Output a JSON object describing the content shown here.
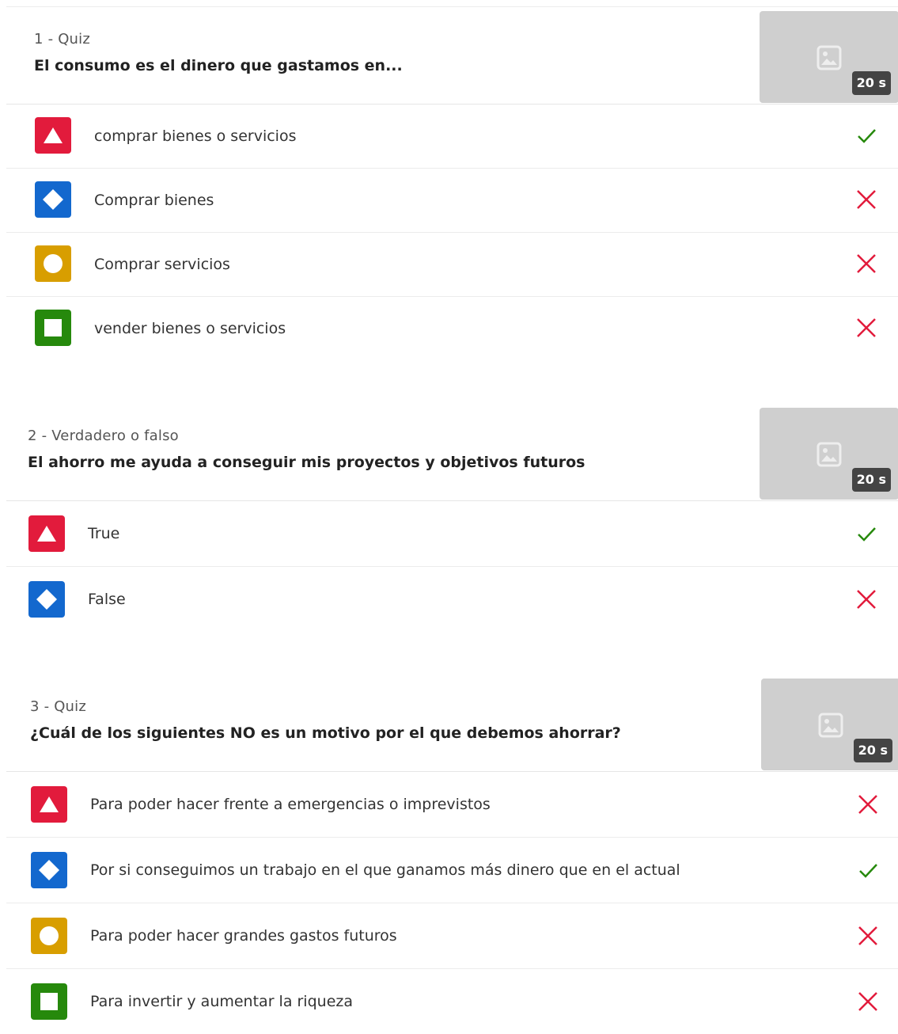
{
  "questions": [
    {
      "type_label": "1 - Quiz",
      "title": "El consumo es el dinero que gastamos en...",
      "time": "20 s",
      "answers": [
        {
          "shape": "triangle",
          "color": "#e21b3c",
          "text": "comprar bienes o servicios",
          "correct": true
        },
        {
          "shape": "diamond",
          "color": "#1368ce",
          "text": "Comprar bienes",
          "correct": false
        },
        {
          "shape": "circle",
          "color": "#d89e00",
          "text": "Comprar servicios",
          "correct": false
        },
        {
          "shape": "square",
          "color": "#26890c",
          "text": "vender bienes o servicios",
          "correct": false
        }
      ]
    },
    {
      "type_label": "2 - Verdadero o falso",
      "title": "El ahorro me ayuda a conseguir mis proyectos y objetivos futuros",
      "time": "20 s",
      "answers": [
        {
          "shape": "triangle",
          "color": "#e21b3c",
          "text": "True",
          "correct": true
        },
        {
          "shape": "diamond",
          "color": "#1368ce",
          "text": "False",
          "correct": false
        }
      ]
    },
    {
      "type_label": "3 - Quiz",
      "title": "¿Cuál de los siguientes NO es un motivo por el que debemos ahorrar?",
      "time": "20 s",
      "answers": [
        {
          "shape": "triangle",
          "color": "#e21b3c",
          "text": "Para poder hacer frente a emergencias o imprevistos",
          "correct": false
        },
        {
          "shape": "diamond",
          "color": "#1368ce",
          "text": "Por si conseguimos un trabajo en el que ganamos más dinero que en el actual",
          "correct": true
        },
        {
          "shape": "circle",
          "color": "#d89e00",
          "text": "Para poder hacer grandes gastos futuros",
          "correct": false
        },
        {
          "shape": "square",
          "color": "#26890c",
          "text": "Para invertir y aumentar la riqueza",
          "correct": false
        }
      ]
    }
  ],
  "icons": {
    "image_placeholder": "image-icon",
    "correct": "check-icon",
    "incorrect": "cross-icon"
  },
  "colors": {
    "correct": "#26890c",
    "incorrect": "#e21b3c",
    "thumbnail_bg": "#cfcfcf",
    "badge_bg": "#444444"
  }
}
